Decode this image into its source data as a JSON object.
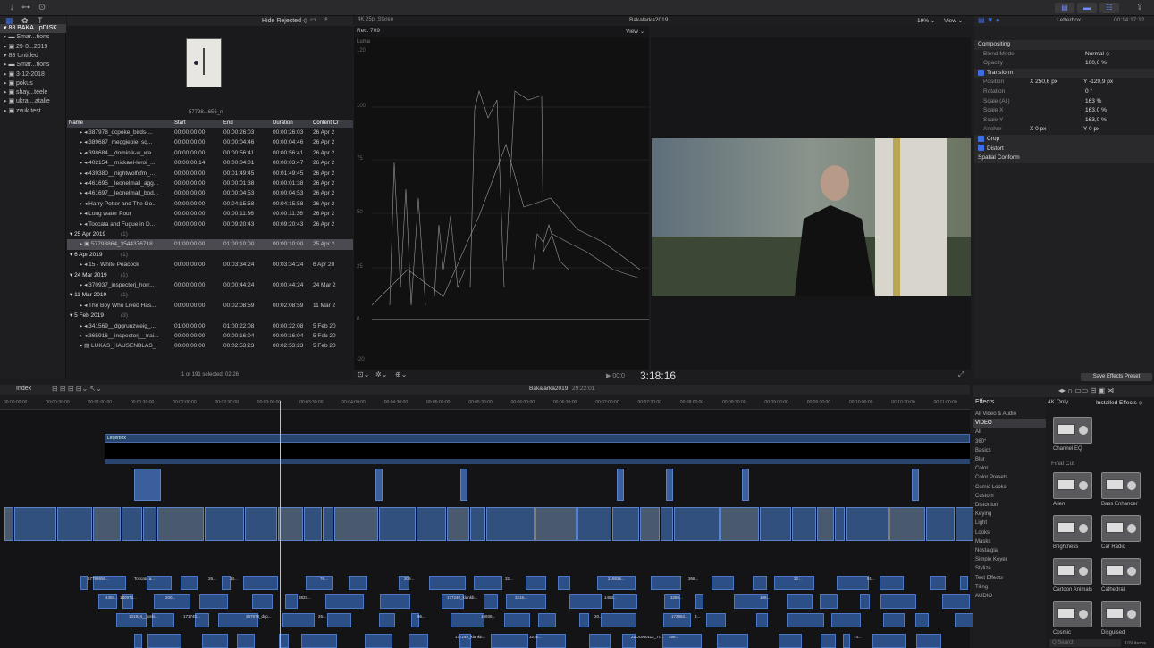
{
  "toolbar": {
    "import": "↓",
    "keywords": "⊶",
    "check": "⊙",
    "share": "⇪"
  },
  "library": {
    "items": [
      {
        "label": "▾ 88 BAKA...pDISK",
        "selected": true
      },
      {
        "label": "▸ ▬ Smar...tions"
      },
      {
        "label": "▸ ▣ 29-0...2019"
      },
      {
        "label": "▾ 88 Untitled"
      },
      {
        "label": "▸ ▬ Smar...tions"
      },
      {
        "label": "▸ ▣ 3-12-2018"
      },
      {
        "label": "▸ ▣ pokus"
      },
      {
        "label": "▸ ▣ shay...teele"
      },
      {
        "label": "▸ ▣ ukraj...atalie"
      },
      {
        "label": "▸ ▣ zvuk test"
      }
    ]
  },
  "browser": {
    "filter": "Hide Rejected ◇",
    "thumb_label": "57798...656_n",
    "columns": [
      "Name",
      "Start",
      "End",
      "Duration",
      "Content Cr"
    ],
    "rows": [
      {
        "name": "▸ ◂ 387978_dcpoke_birds-...",
        "start": "00:00:00:00",
        "end": "00:00:26:03",
        "dur": "00:00:26:03",
        "cc": "26 Apr 2"
      },
      {
        "name": "▸ ◂ 389687_meggiepie_sq...",
        "start": "00:00:00:00",
        "end": "00:00:04:46",
        "dur": "00:00:04:46",
        "cc": "26 Apr 2"
      },
      {
        "name": "▸ ◂ 398684__dominik-w_wa...",
        "start": "00:00:00:00",
        "end": "00:00:56:41",
        "dur": "00:00:56:41",
        "cc": "26 Apr 2"
      },
      {
        "name": "▸ ◂ 402154__mickael-leroi_...",
        "start": "00:00:00:14",
        "end": "00:00:04:01",
        "dur": "00:00:03:47",
        "cc": "26 Apr 2"
      },
      {
        "name": "▸ ◂ 439380__nightwolfcfm_...",
        "start": "00:00:00:00",
        "end": "00:01:49:45",
        "dur": "00:01:49:45",
        "cc": "26 Apr 2"
      },
      {
        "name": "▸ ◂ 461695__leonelmail_agg...",
        "start": "00:00:00:00",
        "end": "00:00:01:38",
        "dur": "00:00:01:38",
        "cc": "26 Apr 2"
      },
      {
        "name": "▸ ◂ 461697__leonelmail_bod...",
        "start": "00:00:00:00",
        "end": "00:00:04:53",
        "dur": "00:00:04:53",
        "cc": "26 Apr 2"
      },
      {
        "name": "▸ ◂ Harry Potter and The Go...",
        "start": "00:00:00:00",
        "end": "00:04:15:58",
        "dur": "00:04:15:58",
        "cc": "26 Apr 2"
      },
      {
        "name": "▸ ◂ Long water Pour",
        "start": "00:00:00:00",
        "end": "00:00:11:36",
        "dur": "00:00:11:36",
        "cc": "26 Apr 2"
      },
      {
        "name": "▸ ◂ Toccata and Fugue in D...",
        "start": "00:00:00:00",
        "end": "00:09:20:43",
        "dur": "00:09:20:43",
        "cc": "26 Apr 2"
      },
      {
        "group": "▾ 25 Apr 2019",
        "count": "(1)"
      },
      {
        "name": "▸ ▣ 57798864_3544376718...",
        "start": "01:00:00:00",
        "end": "01:00:10:00",
        "dur": "00:00:10:00",
        "cc": "25 Apr 2",
        "selected": true
      },
      {
        "group": "▾ 6 Apr 2019",
        "count": "(1)"
      },
      {
        "name": "▸ ◂ 15 - White Peacock",
        "start": "00:00:00:00",
        "end": "00:03:34:24",
        "dur": "00:03:34:24",
        "cc": "6 Apr 20"
      },
      {
        "group": "▾ 24 Mar 2019",
        "count": "(1)"
      },
      {
        "name": "▸ ◂ 370937_inspectorj_horr...",
        "start": "00:00:00:00",
        "end": "00:00:44:24",
        "dur": "00:00:44:24",
        "cc": "24 Mar 2"
      },
      {
        "group": "▾ 11 Mar 2019",
        "count": "(1)"
      },
      {
        "name": "▸ ◂ The Boy Who Lived Has...",
        "start": "00:00:00:00",
        "end": "00:02:08:59",
        "dur": "00:02:08:59",
        "cc": "11 Mar 2"
      },
      {
        "group": "▾ 5 Feb 2019",
        "count": "(3)"
      },
      {
        "name": "▸ ◂ 341569__dggrunzweig_...",
        "start": "01:00:00:00",
        "end": "01:00:22:08",
        "dur": "00:00:22:08",
        "cc": "5 Feb 20"
      },
      {
        "name": "▸ ◂ 365916__inspectorj__trai...",
        "start": "00:00:00:00",
        "end": "00:00:16:04",
        "dur": "00:00:16:04",
        "cc": "5 Feb 20"
      },
      {
        "name": "▸ ▤ LUKAS_HAUSENBLAS_",
        "start": "00:00:00:00",
        "end": "00:02:53:23",
        "dur": "00:02:53:23",
        "cc": "5 Feb 20"
      }
    ],
    "status": "1 of 191 selected, 02:26"
  },
  "viewer": {
    "format": "4K 25p, Stereo",
    "title": "Bakalarka2019",
    "zoom": "19% ⌄",
    "view": "View ⌄",
    "scope_mode": "Rec. 709",
    "scope_view": "View ⌄",
    "scope_type": "Luma",
    "scale": [
      "120",
      "100",
      "75",
      "50",
      "25",
      "0",
      "-20"
    ],
    "timecode": "3:18:16",
    "timecode_prefix": "▶ 00:0"
  },
  "inspector": {
    "clip": "Letterbox",
    "time": "00:14:17:12",
    "rows": [
      {
        "label": "Compositing",
        "section": true
      },
      {
        "label": "Blend Mode",
        "value": "Normal ◇"
      },
      {
        "label": "Opacity",
        "value": "100,0 %"
      },
      {
        "label": "Transform",
        "section": true,
        "checked": true
      },
      {
        "label": "Position",
        "x": "X  250,6 px",
        "y": "Y  -129,9 px"
      },
      {
        "label": "Rotation",
        "value": "0 °"
      },
      {
        "label": "Scale (All)",
        "value": "163 %"
      },
      {
        "label": "Scale X",
        "value": "163,0 %"
      },
      {
        "label": "Scale Y",
        "value": "163,0 %"
      },
      {
        "label": "Anchor",
        "x": "X  0 px",
        "y": "Y  0 px"
      },
      {
        "label": "Crop",
        "section": true,
        "checked": true
      },
      {
        "label": "Distort",
        "section": true,
        "checked": true
      },
      {
        "label": "Spatial Conform",
        "section": true
      }
    ],
    "save_preset": "Save Effects Preset"
  },
  "timeline": {
    "index": "Index",
    "title": "Bakalarka2019",
    "duration": "29:22:01",
    "ruler": [
      "00:00:00:00",
      "00:00:30:00",
      "00:01:00:00",
      "00:01:30:00",
      "00:02:00:00",
      "00:02:30:00",
      "00:03:00:00",
      "00:03:30:00",
      "00:04:00:00",
      "00:04:30:00",
      "00:05:00:00",
      "00:05:30:00",
      "00:06:00:00",
      "00:06:30:00",
      "00:07:00:00",
      "00:07:30:00",
      "00:08:00:00",
      "00:08:30:00",
      "00:09:00:00",
      "00:09:30:00",
      "00:10:00:00",
      "00:10:30:00",
      "00:11:00:00"
    ],
    "letterbox_label": "Letterbox",
    "clip_labels": [
      "57798656...",
      "Toccata a...",
      "26...",
      "14...",
      "76...",
      "209...",
      "32...",
      "218625...",
      "368...",
      "32...",
      "91...",
      "4393...",
      "130972...",
      "200...",
      "3837...",
      "177240_klankb...",
      "3216...",
      "1453...",
      "3286...",
      "148...",
      "101934__luski...",
      "171740...",
      "387978_dcp...",
      "26...",
      "96...",
      "16935...",
      "20...",
      "172862...",
      "3...",
      "177240_klankb...",
      "3216...",
      "2ZOOM0112_Tr...",
      "398...",
      "74..."
    ]
  },
  "effects": {
    "title": "Effects",
    "filter_4k": "4K Only",
    "installed": "Installed Effects ◇",
    "categories": [
      "All Video & Audio",
      "VIDEO",
      "All",
      "360°",
      "Basics",
      "Blur",
      "Color",
      "Color Presets",
      "Comic Looks",
      "Custom",
      "Distortion",
      "Keying",
      "Light",
      "Looks",
      "Masks",
      "Nostalgia",
      "Simple Keyer",
      "Stylize",
      "Text Effects",
      "Tiling",
      "AUDIO"
    ],
    "section": "Final Cut",
    "tiles": [
      "Channel EQ",
      "Alien",
      "Bass Enhancer",
      "Brightness",
      "Car Radio",
      "Cartoon Animals",
      "Cathedral",
      "Cosmic",
      "Disguised"
    ],
    "search": "Q Search",
    "count": "109 items"
  }
}
